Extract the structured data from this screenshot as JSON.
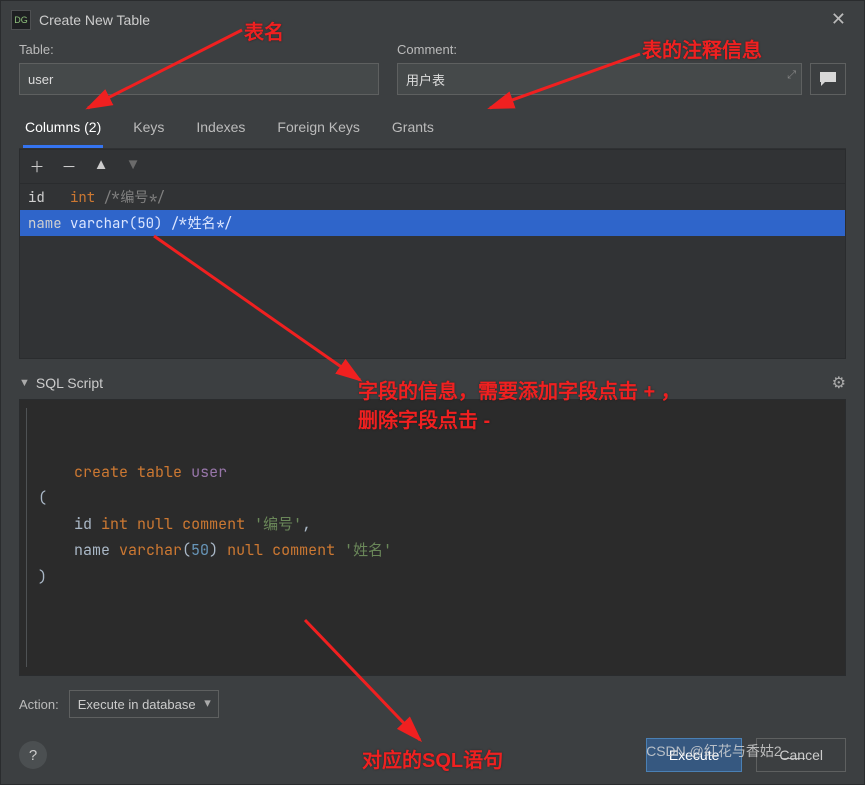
{
  "dialog": {
    "title": "Create New Table",
    "table_label": "Table:",
    "comment_label": "Comment:",
    "table_value": "user",
    "comment_value": "用户表"
  },
  "tabs": {
    "columns": "Columns (2)",
    "keys": "Keys",
    "indexes": "Indexes",
    "foreign_keys": "Foreign Keys",
    "grants": "Grants"
  },
  "columns": [
    {
      "name": "id",
      "type": "int",
      "comment": "/*编号*/",
      "selected": false
    },
    {
      "name": "name",
      "type": "varchar(50)",
      "comment": "/*姓名*/",
      "selected": true
    }
  ],
  "sql": {
    "header": "SQL Script",
    "tokens": [
      [
        "kw",
        "create"
      ],
      [
        "sp",
        " "
      ],
      [
        "kw",
        "table"
      ],
      [
        "sp",
        " "
      ],
      [
        "ident",
        "user"
      ],
      [
        "nl"
      ],
      [
        "plain",
        "("
      ],
      [
        "nl"
      ],
      [
        "sp",
        "    "
      ],
      [
        "plain",
        "id "
      ],
      [
        "kw",
        "int"
      ],
      [
        "sp",
        " "
      ],
      [
        "kw",
        "null"
      ],
      [
        "sp",
        " "
      ],
      [
        "kw",
        "comment"
      ],
      [
        "sp",
        " "
      ],
      [
        "str",
        "'编号'"
      ],
      [
        "plain",
        ","
      ],
      [
        "nl"
      ],
      [
        "sp",
        "    "
      ],
      [
        "plain",
        "name "
      ],
      [
        "kw",
        "varchar"
      ],
      [
        "plain",
        "("
      ],
      [
        "num",
        "50"
      ],
      [
        "plain",
        ") "
      ],
      [
        "kw",
        "null"
      ],
      [
        "sp",
        " "
      ],
      [
        "kw",
        "comment"
      ],
      [
        "sp",
        " "
      ],
      [
        "str",
        "'姓名'"
      ],
      [
        "nl"
      ],
      [
        "plain",
        ")"
      ]
    ]
  },
  "action": {
    "label": "Action:",
    "selected": "Execute in database"
  },
  "buttons": {
    "execute": "Execute",
    "cancel": "Cancel"
  },
  "annotations": {
    "a1": "表名",
    "a2": "表的注释信息",
    "a3_line1": "字段的信息，需要添加字段点击 + ，",
    "a3_line2": "删除字段点击 -",
    "a4": "对应的SQL语句"
  },
  "watermark": "CSDN @红花与香姑2___"
}
